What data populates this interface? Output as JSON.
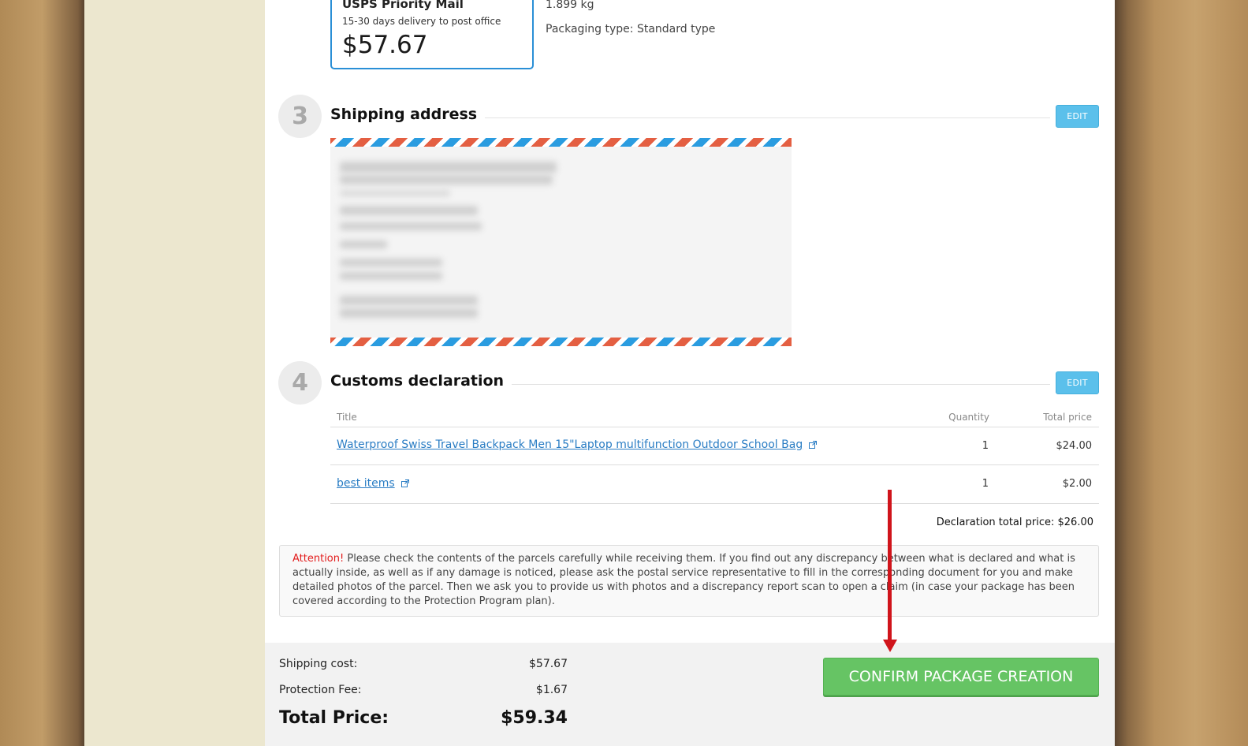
{
  "carrier": {
    "name": "USPS Priority Mail",
    "delivery": "15-30 days delivery to post office",
    "price": "$57.67"
  },
  "package_info": {
    "weight": "1.899 kg",
    "packaging": "Packaging type: Standard type"
  },
  "shipping_address": {
    "step": "3",
    "title": "Shipping address",
    "edit_label": "EDIT"
  },
  "customs": {
    "step": "4",
    "title": "Customs declaration",
    "edit_label": "EDIT",
    "columns": {
      "title": "Title",
      "quantity": "Quantity",
      "total_price": "Total price"
    },
    "items": [
      {
        "title": "Waterproof Swiss Travel Backpack Men 15\"Laptop multifunction Outdoor School Bag",
        "quantity": "1",
        "price": "$24.00"
      },
      {
        "title": "best items",
        "quantity": "1",
        "price": "$2.00"
      }
    ],
    "declaration_total": "Declaration total price: $26.00"
  },
  "attention": {
    "label": "Attention!",
    "text": "Please check the contents of the parcels carefully while receiving them. If you find out any discrepancy between what is declared and what is actually inside, as well as if any damage is noticed, please ask the postal service representative to fill in the corresponding document for you and make detailed photos of the parcel. Then we ask you to provide us with photos and a discrepancy report scan to open a claim (in case your package has been covered according to the Protection Program plan)."
  },
  "summary": {
    "shipping_cost_label": "Shipping cost:",
    "shipping_cost": "$57.67",
    "protection_fee_label": "Protection Fee:",
    "protection_fee": "$1.67",
    "total_label": "Total Price:",
    "total": "$59.34",
    "confirm_label": "CONFIRM PACKAGE CREATION"
  },
  "colors": {
    "accent_blue": "#2a8fd6",
    "edit_button": "#5bc0eb",
    "confirm_button": "#66c464",
    "attention_red": "#e21b1b",
    "annotation_arrow": "#d0141b"
  }
}
